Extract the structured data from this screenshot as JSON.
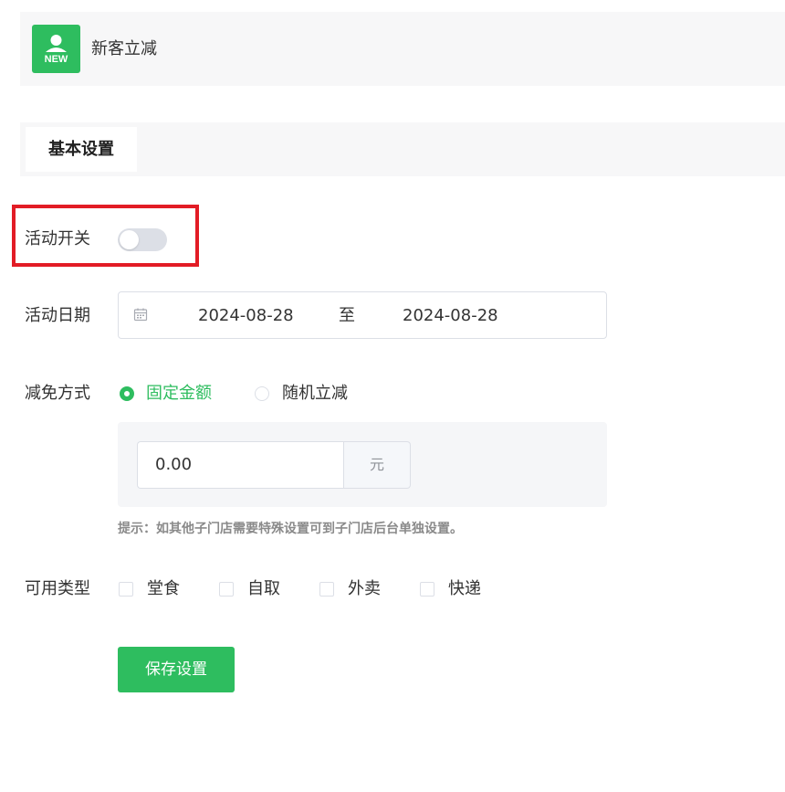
{
  "header": {
    "title": "新客立减",
    "icon_name": "new-user-icon",
    "icon_text": "NEW",
    "accent": "#2ebd5f"
  },
  "tabs": [
    {
      "label": "基本设置",
      "active": true
    }
  ],
  "form": {
    "toggle": {
      "label": "活动开关",
      "on": false
    },
    "date": {
      "label": "活动日期",
      "start": "2024-08-28",
      "separator": "至",
      "end": "2024-08-28"
    },
    "discount": {
      "label": "减免方式",
      "options": [
        {
          "label": "固定金额",
          "checked": true
        },
        {
          "label": "随机立减",
          "checked": false
        }
      ],
      "amount_value": "0.00",
      "amount_unit": "元"
    },
    "hint": "提示：如其他子门店需要特殊设置可到子门店后台单独设置。",
    "types": {
      "label": "可用类型",
      "options": [
        {
          "label": "堂食",
          "checked": false
        },
        {
          "label": "自取",
          "checked": false
        },
        {
          "label": "外卖",
          "checked": false
        },
        {
          "label": "快递",
          "checked": false
        }
      ]
    },
    "save_label": "保存设置"
  },
  "colors": {
    "primary": "#2ebd5f",
    "highlight_border": "#e21c25"
  }
}
